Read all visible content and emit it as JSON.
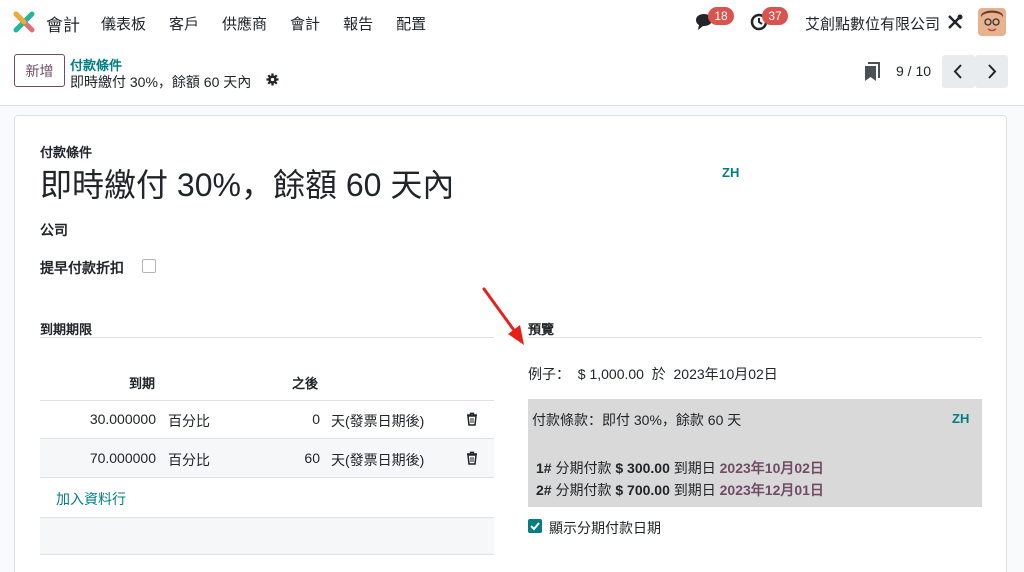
{
  "navbar": {
    "app_name": "會計",
    "menu": [
      "儀表板",
      "客戶",
      "供應商",
      "會計",
      "報告",
      "配置"
    ],
    "message_count": "18",
    "activity_count": "37",
    "company": "艾創點數位有限公司"
  },
  "control_panel": {
    "new_label": "新增",
    "breadcrumb_parent": "付款條件",
    "breadcrumb_current": "即時繳付 30%，餘額 60 天內",
    "pager": "9 / 10"
  },
  "form": {
    "name_label": "付款條件",
    "name": "即時繳付 30%，餘額 60 天內",
    "lang": "ZH",
    "company_label": "公司",
    "early_discount_label": "提早付款折扣",
    "terms_section": "到期期限",
    "preview_section": "預覽",
    "table": {
      "col_due": "到期",
      "col_after": "之後",
      "rows": [
        {
          "value": "30.000000",
          "type": "百分比",
          "days": "0",
          "option": "天(發票日期後)"
        },
        {
          "value": "70.000000",
          "type": "百分比",
          "days": "60",
          "option": "天(發票日期後)"
        }
      ],
      "add_line": "加入資料行"
    },
    "preview": {
      "example": "例子：  $ 1,000.00  於  2023年10月02日",
      "title": "付款條款：即付 30%，餘款 60 天",
      "lang": "ZH",
      "installments": [
        {
          "num": "1#",
          "text1": " 分期付款 ",
          "amount": "$ 300.00",
          "text2": " 到期日 ",
          "date": "2023年10月02日"
        },
        {
          "num": "2#",
          "text1": " 分期付款 ",
          "amount": "$ 700.00",
          "text2": " 到期日 ",
          "date": "2023年12月01日"
        }
      ],
      "show_dates_label": "顯示分期付款日期"
    }
  },
  "colors": {
    "brand": "#714b67",
    "accent": "#017e84",
    "badge": "#d9534f",
    "arrow": "#e8201a"
  }
}
